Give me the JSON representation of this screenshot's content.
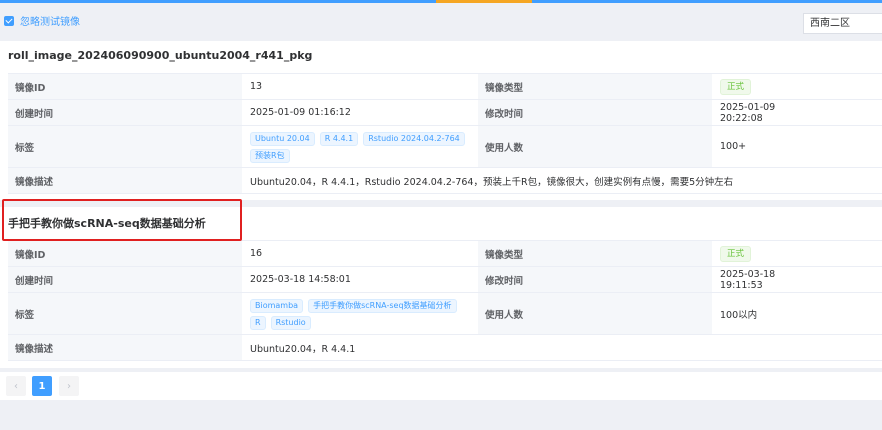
{
  "topbar": {
    "checkbox_label": "忽略测试镜像",
    "region": "西南二区"
  },
  "cards": [
    {
      "title": "roll_image_202406090900_ubuntu2004_r441_pkg",
      "id_label": "镜像ID",
      "id": "13",
      "type_label": "镜像类型",
      "type": "正式",
      "created_label": "创建时间",
      "created": "2025-01-09 01:16:12",
      "modified_label": "修改时间",
      "modified": "2025-01-09 20:22:08",
      "tags_label": "标签",
      "tags": [
        "Ubuntu 20.04",
        "R 4.4.1",
        "Rstudio 2024.04.2-764",
        "预装R包"
      ],
      "users_label": "使用人数",
      "users": "100+",
      "desc_label": "镜像描述",
      "desc": "Ubuntu20.04，R 4.4.1，Rstudio 2024.04.2-764，预装上千R包，镜像很大，创建实例有点慢，需要5分钟左右"
    },
    {
      "title": "手把手教你做scRNA-seq数据基础分析",
      "id_label": "镜像ID",
      "id": "16",
      "type_label": "镜像类型",
      "type": "正式",
      "created_label": "创建时间",
      "created": "2025-03-18 14:58:01",
      "modified_label": "修改时间",
      "modified": "2025-03-18 19:11:53",
      "tags_label": "标签",
      "tags": [
        "Biomamba",
        "手把手教你做scRNA-seq数据基础分析",
        "R",
        "Rstudio"
      ],
      "users_label": "使用人数",
      "users": "100以内",
      "desc_label": "镜像描述",
      "desc": "Ubuntu20.04，R 4.4.1"
    }
  ],
  "pagination": {
    "prev": "‹",
    "current": "1",
    "next": "›"
  },
  "colors": {
    "primary": "#409eff",
    "success": "#67c23a",
    "highlight_box": "#e02020",
    "accent_bar": "#f5a623"
  }
}
